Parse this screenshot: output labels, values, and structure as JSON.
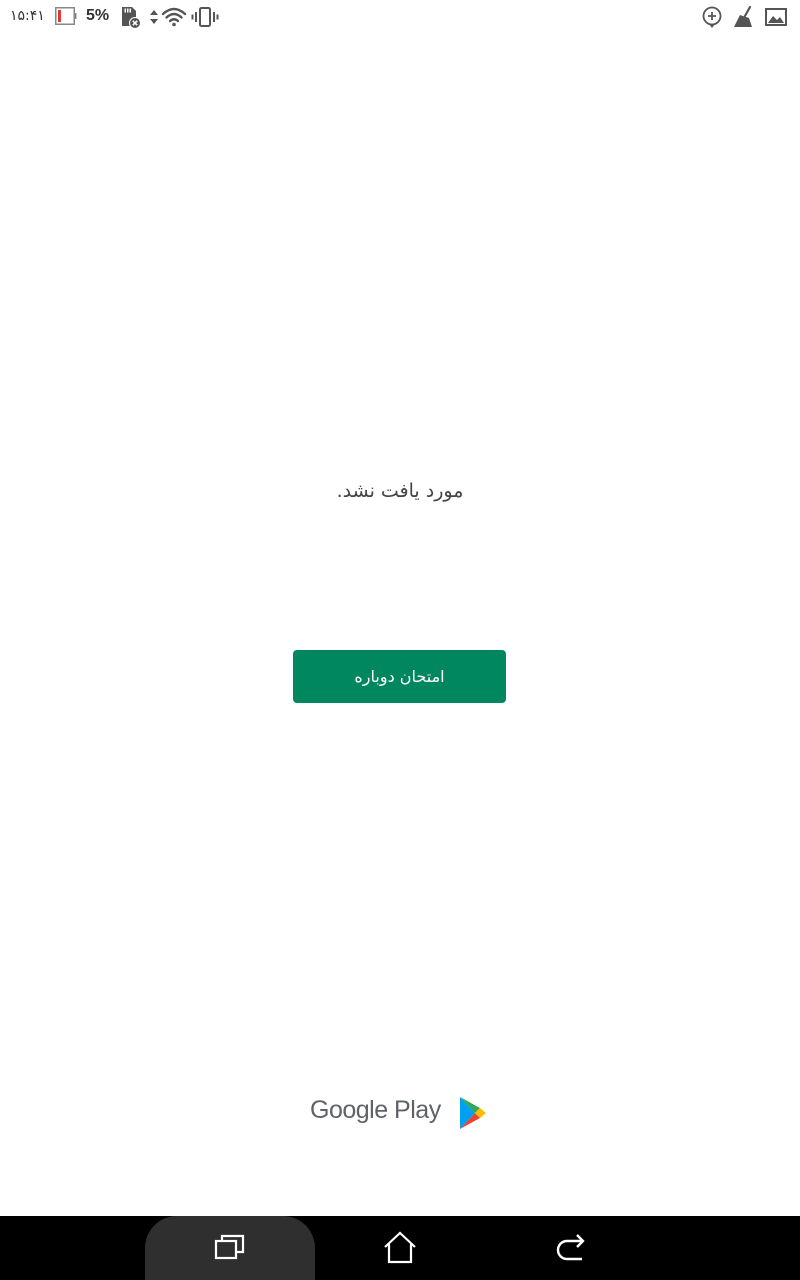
{
  "status_bar": {
    "time": "۱۵:۴۱",
    "battery_percent": "5%",
    "battery_level": 0.05,
    "icons_left": [
      "battery-icon",
      "sd-card-error-icon",
      "data-arrows-icon",
      "wifi-icon",
      "vibrate-icon"
    ],
    "icons_right": [
      "location-pin-icon",
      "cleaner-icon",
      "image-icon"
    ]
  },
  "main": {
    "message": "مورد یافت نشد.",
    "retry_label": "امتحان دوباره"
  },
  "branding": {
    "google_play_text": "Google Play"
  },
  "nav_bar": {
    "buttons": [
      "recents-icon",
      "home-icon",
      "back-icon"
    ]
  },
  "colors": {
    "accent": "#01875f",
    "text": "#444444",
    "nav_background": "#000000"
  }
}
